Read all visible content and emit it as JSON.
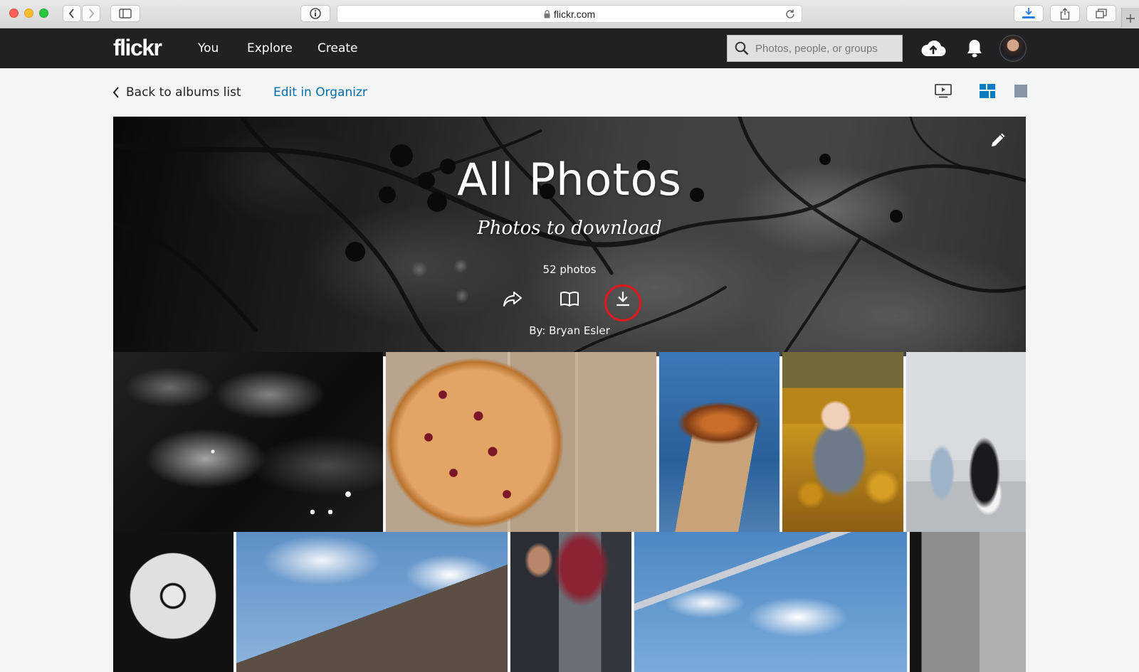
{
  "browser": {
    "url": "flickr.com"
  },
  "nav": {
    "logo": "flickr",
    "items": [
      "You",
      "Explore",
      "Create"
    ],
    "search_placeholder": "Photos, people, or groups"
  },
  "subnav": {
    "back_label": "Back to albums list",
    "organizr_label": "Edit in Organizr"
  },
  "album": {
    "title": "All Photos",
    "description": "Photos to download",
    "count": "52 photos",
    "by": "By: Bryan Esler"
  },
  "colors": {
    "nav_bg": "#212124",
    "link_blue": "#006dac",
    "highlight_red": "#e3161b",
    "page_bg": "#f3f5f6"
  },
  "icons": {
    "share": "share-icon",
    "photobook": "book-icon",
    "download": "download-icon",
    "edit": "pencil-icon",
    "upload": "cloud-upload-icon",
    "notifications": "bell-icon",
    "slideshow": "slideshow-icon",
    "justified_view": "grid-view-icon",
    "single_view": "square-view-icon"
  }
}
